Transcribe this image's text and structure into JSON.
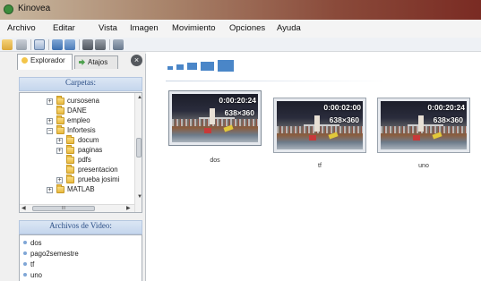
{
  "window": {
    "title": "Kinovea"
  },
  "menu": [
    "Archivo",
    "Editar",
    "Vista",
    "Imagen",
    "Movimiento",
    "Opciones",
    "Ayuda"
  ],
  "toolbar": {
    "icons": [
      "open-folder-icon",
      "save-icon",
      "single-player-icon",
      "dual-player-horizontal-icon",
      "dual-player-vertical-icon",
      "capture-icon",
      "capture-dual-icon",
      "capture-vertical-icon"
    ]
  },
  "left_panel": {
    "tabs": {
      "explorer": "Explorador",
      "shortcuts": "Atajos"
    },
    "folders_header": "Carpetas:",
    "tree": [
      {
        "label": "cursosena",
        "level": 1,
        "expander": "+"
      },
      {
        "label": "DANE",
        "level": 1,
        "expander": ""
      },
      {
        "label": "empleo",
        "level": 1,
        "expander": "+"
      },
      {
        "label": "Infortesis",
        "level": 1,
        "expander": "−"
      },
      {
        "label": "docum",
        "level": 2,
        "expander": "+"
      },
      {
        "label": "paginas",
        "level": 2,
        "expander": "+"
      },
      {
        "label": "pdfs",
        "level": 2,
        "expander": ""
      },
      {
        "label": "presentacion",
        "level": 2,
        "expander": ""
      },
      {
        "label": "prueba josimi",
        "level": 2,
        "expander": "+"
      },
      {
        "label": "MATLAB",
        "level": 1,
        "expander": "+"
      }
    ],
    "hscroll_label": "III",
    "videos_header": "Archivos de Video:",
    "videos": [
      "dos",
      "pago2semestre",
      "tf",
      "uno"
    ]
  },
  "main": {
    "thumbnails": [
      {
        "name": "dos",
        "duration": "0:00:20:24",
        "resolution": "638×360",
        "selected": true
      },
      {
        "name": "tf",
        "duration": "0:00:02:00",
        "resolution": "638×360",
        "selected": false
      },
      {
        "name": "uno",
        "duration": "0:00:20:24",
        "resolution": "638×360",
        "selected": false
      }
    ]
  },
  "colors": {
    "accent": "#4a86c8",
    "header_text": "#2c4f86",
    "titlebar_end": "#7a2b23"
  }
}
